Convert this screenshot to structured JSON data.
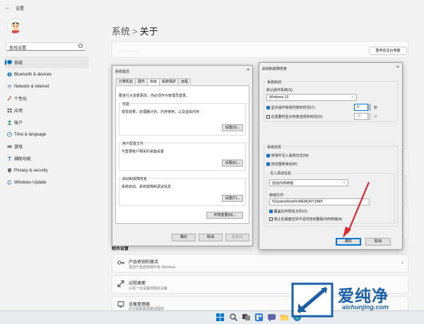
{
  "app": {
    "title": "设置"
  },
  "search": {
    "value": "查找设置"
  },
  "nav": [
    {
      "label": "系统",
      "icon": "monitor-icon",
      "color": "#0067c0",
      "active": true
    },
    {
      "label": "Bluetooth & devices",
      "icon": "bluetooth-icon",
      "color": "#0067c0"
    },
    {
      "label": "Network & internet",
      "icon": "wifi-icon",
      "color": "#3b7dc4"
    },
    {
      "label": "个性化",
      "icon": "brush-icon",
      "color": "#c05a2a"
    },
    {
      "label": "应用",
      "icon": "apps-icon",
      "color": "#6b6b6b"
    },
    {
      "label": "帐户",
      "icon": "person-icon",
      "color": "#2e9a5a"
    },
    {
      "label": "Time & language",
      "icon": "globe-clock-icon",
      "color": "#2b7cd3"
    },
    {
      "label": "游戏",
      "icon": "gamepad-icon",
      "color": "#6b6b6b"
    },
    {
      "label": "辅助功能",
      "icon": "accessibility-icon",
      "color": "#2b7cd3"
    },
    {
      "label": "Privacy & security",
      "icon": "shield-icon",
      "color": "#6b6b6b"
    },
    {
      "label": "Windows Update",
      "icon": "update-icon",
      "color": "#2b7cd3"
    }
  ],
  "breadcrumb": {
    "parent": "系统",
    "sep": ">",
    "current": "关于"
  },
  "top_card": {
    "dots": "··········",
    "rename_label": "重命名这台电脑"
  },
  "related": {
    "heading": "相关设置",
    "items": [
      {
        "title": "产品密钥和激活",
        "subtitle": "更改产品密钥或升级 Windows",
        "icon": "key-icon"
      },
      {
        "title": "远程桌面",
        "subtitle": "从另一台设备控制此设备",
        "icon": "remote-icon"
      },
      {
        "title": "设备管理器",
        "subtitle": "打印机和其他驱动程序",
        "icon": "device-icon"
      }
    ]
  },
  "sysprop": {
    "title": "系统属性",
    "tabs": [
      "计算机名",
      "硬件",
      "高级",
      "系统保护",
      "远程"
    ],
    "active_tab": 2,
    "note": "要进行大多数更改，你必须作为管理员登录。",
    "groups": [
      {
        "title": "性能",
        "desc": "视觉效果，处理器计划，内存使用，以及虚拟内存",
        "button": "设置(S)..."
      },
      {
        "title": "用户配置文件",
        "desc": "与登录帐户相关的桌面设置",
        "button": "设置(E)..."
      },
      {
        "title": "启动和故障恢复",
        "desc": "系统启动、系统故障和调试信息",
        "button": "设置(T)..."
      }
    ],
    "env_button": "环境变量(N)...",
    "ok": "确定",
    "cancel": "取消",
    "apply": "应用(A)"
  },
  "startup": {
    "title": "启动和故障恢复",
    "section1": "系统启动",
    "default_os_label": "默认操作系统(S):",
    "default_os_value": "Windows 10",
    "show_os_list_label": "显示操作系统列表的时间(T):",
    "show_os_list_value": "0",
    "show_recovery_label": "在需要时显示恢复选项的时间(D):",
    "show_recovery_value": "30",
    "sec_unit": "秒",
    "section2": "系统失败",
    "write_log_label": "将事件写入系统日志(W)",
    "auto_restart_label": "自动重新启动(R)",
    "debug_section": "写入调试信息",
    "debug_value": "自动内存转储",
    "dump_file_label": "转储文件:",
    "dump_file_value": "%SystemRoot%\\MEMORY.DMP",
    "overwrite_label": "覆盖任何现有文件(O)",
    "disable_auto_delete_label": "禁止在磁盘空间不足时自动删除内存转储(A)",
    "ok": "确定",
    "cancel": "取消"
  },
  "watermark": {
    "name": "爱纯净",
    "url": "aichunjing.com"
  },
  "colors": {
    "accent": "#0067c0",
    "arrow": "#d9272e"
  }
}
